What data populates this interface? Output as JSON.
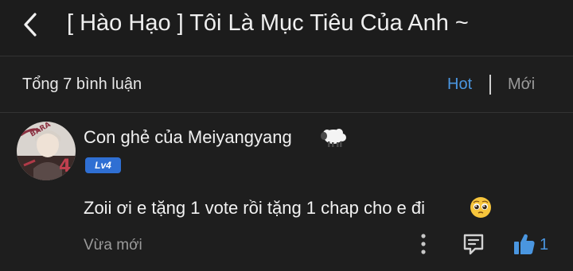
{
  "header": {
    "back_icon": "chevron-left-icon",
    "title": "[ Hào Hạo ] Tôi Là Mục Tiêu Của Anh ~"
  },
  "summary": {
    "count_label": "Tổng 7 bình luận",
    "sort_hot": "Hot",
    "sort_new": "Mới",
    "active_sort_color": "#4a96e0"
  },
  "comment": {
    "avatar_icon": "user-avatar",
    "username": "Con ghẻ của Meiyangyang",
    "username_emoji": "sheep-icon",
    "level": "Lv4",
    "level_color": "#2f6fd3",
    "text": "Zoii ơi e tặng 1 vote rồi tặng 1 chap cho e đi",
    "text_emoji": "pleading-face-icon",
    "time": "Vừa mới",
    "like_count": "1"
  }
}
